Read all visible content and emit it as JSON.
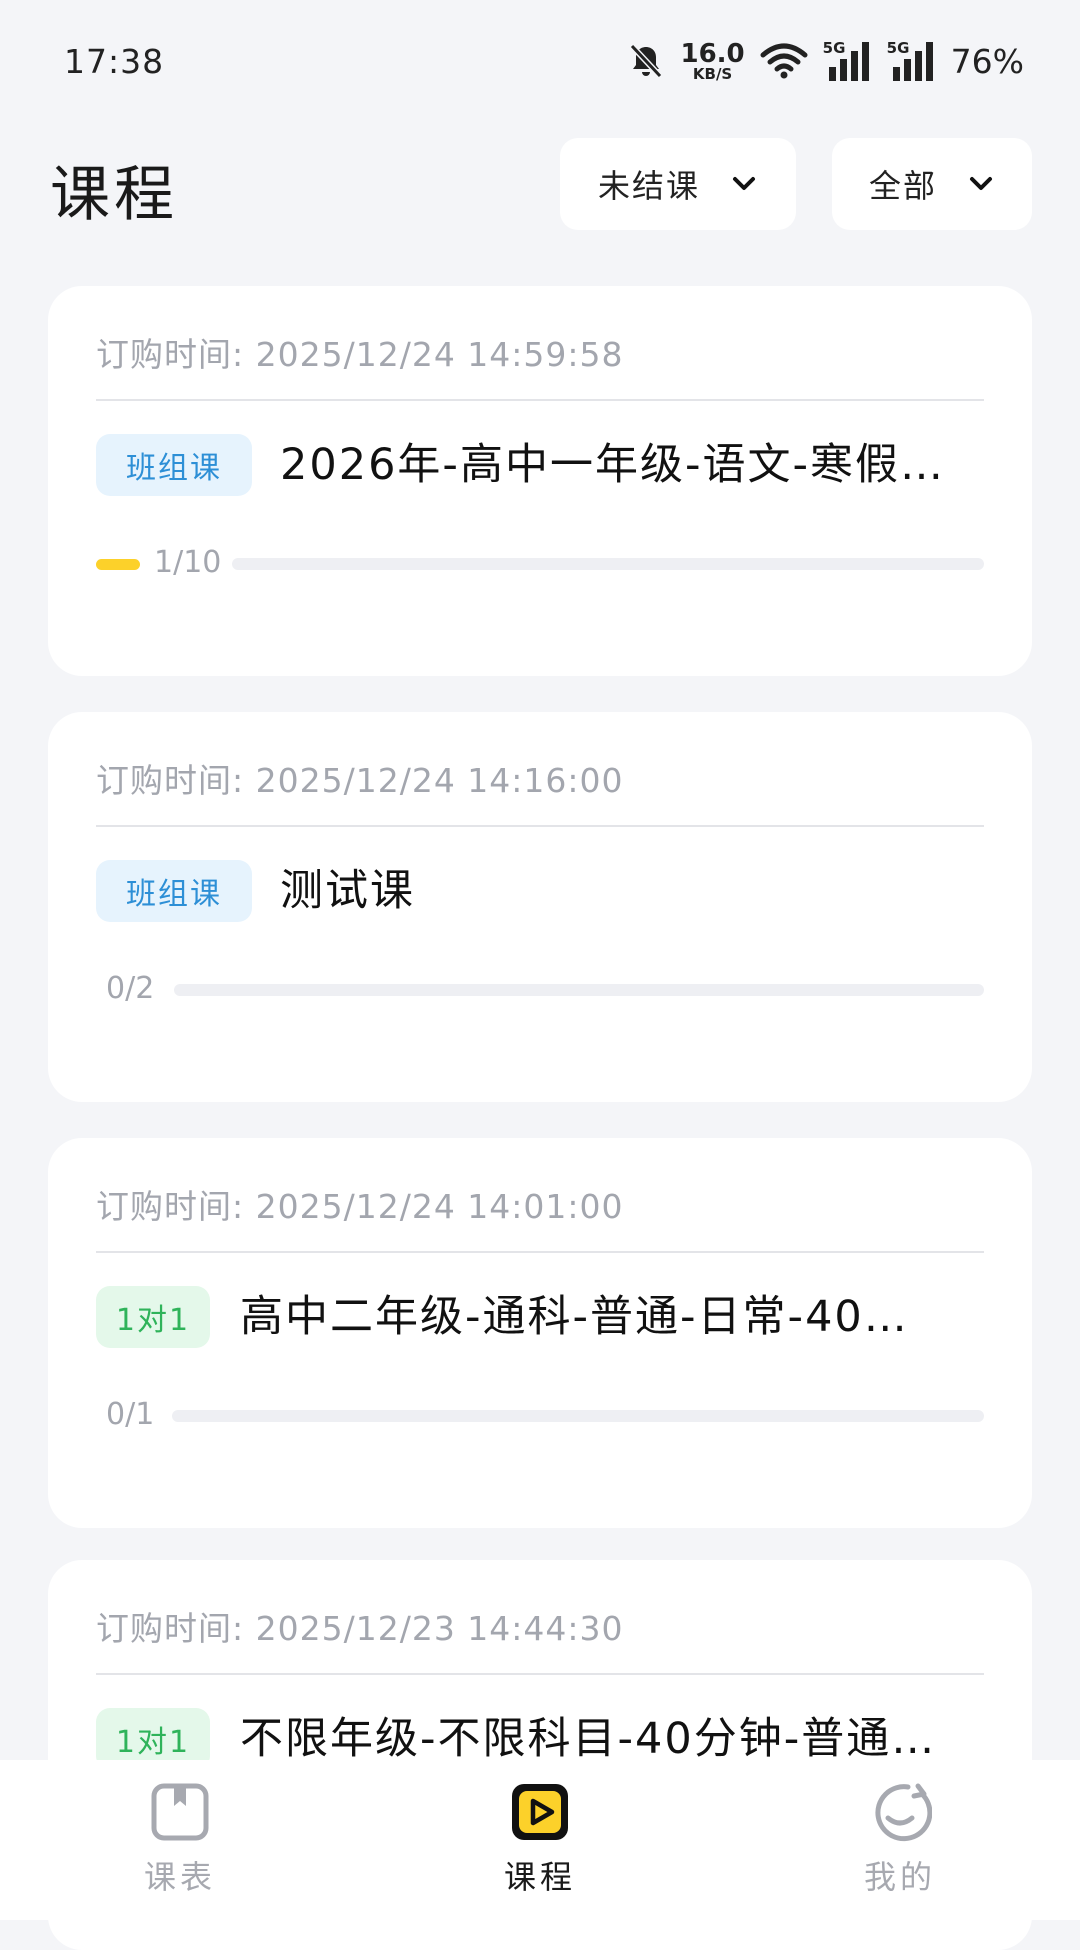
{
  "status_bar": {
    "time": "17:38",
    "net_speed_value": "16.0",
    "net_speed_unit": "KB/S",
    "sim1_tag": "5G",
    "sim2_tag": "5G",
    "battery": "76%",
    "icons": [
      "bell-muted-icon",
      "wifi-icon",
      "signal-icon",
      "signal-icon"
    ]
  },
  "header": {
    "title": "课程",
    "status_filter": "未结课",
    "scope_filter": "全部"
  },
  "courses": [
    {
      "order_time": "订购时间: 2025/12/24 14:59:58",
      "type": "班组课",
      "title": "2026年-高中一年级-语文-寒假…",
      "progress_text": "1/10",
      "progress_fraction": 0.1
    },
    {
      "order_time": "订购时间: 2025/12/24 14:16:00",
      "type": "班组课",
      "title": "测试课",
      "progress_text": "0/2",
      "progress_fraction": 0
    },
    {
      "order_time": "订购时间: 2025/12/24 14:01:00",
      "type": "1对1",
      "title": "高中二年级-通科-普通-日常-40…",
      "progress_text": "0/1",
      "progress_fraction": 0
    },
    {
      "order_time": "订购时间: 2025/12/23 14:44:30",
      "type": "1对1",
      "title": "不限年级-不限科目-40分钟-普通…",
      "progress_text": "",
      "progress_fraction": 0
    }
  ],
  "bottom_nav": {
    "items": [
      {
        "label": "课表",
        "icon": "schedule-icon",
        "active": false
      },
      {
        "label": "课程",
        "icon": "play-course-icon",
        "active": true
      },
      {
        "label": "我的",
        "icon": "smiley-profile-icon",
        "active": false
      }
    ]
  },
  "colors": {
    "background": "#f4f5f8",
    "accent_yellow": "#fcd12a",
    "badge_group_bg": "#e6f3fd",
    "badge_group_text": "#2d8fd6",
    "badge_1v1_bg": "#e4f8ea",
    "badge_1v1_text": "#2fb35a",
    "muted_text": "#a3a6ae"
  }
}
